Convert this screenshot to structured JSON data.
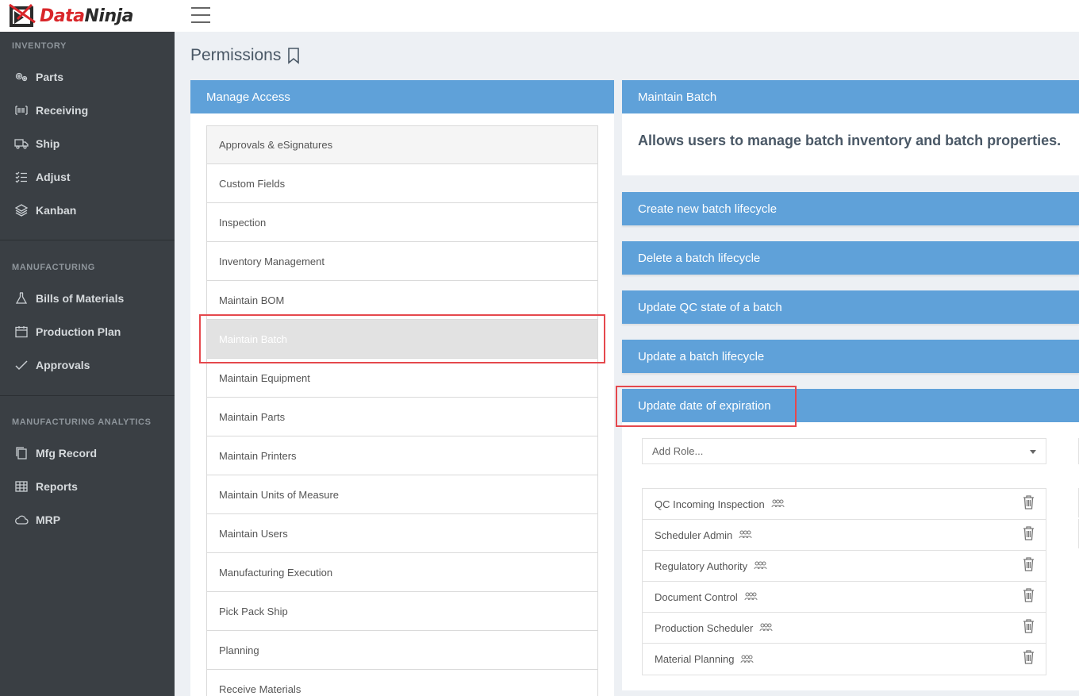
{
  "app": {
    "brand_part1": "Data",
    "brand_part2": "Ninja"
  },
  "sidebar": {
    "sections": [
      {
        "title": "INVENTORY",
        "items": [
          {
            "label": "Parts",
            "icon": "gears-icon"
          },
          {
            "label": "Receiving",
            "icon": "barcode-icon"
          },
          {
            "label": "Ship",
            "icon": "truck-icon"
          },
          {
            "label": "Adjust",
            "icon": "checklist-icon"
          },
          {
            "label": "Kanban",
            "icon": "layers-icon"
          }
        ]
      },
      {
        "title": "MANUFACTURING",
        "items": [
          {
            "label": "Bills of Materials",
            "icon": "flask-icon"
          },
          {
            "label": "Production Plan",
            "icon": "calendar-icon"
          },
          {
            "label": "Approvals",
            "icon": "check-icon"
          }
        ]
      },
      {
        "title": "MANUFACTURING ANALYTICS",
        "items": [
          {
            "label": "Mfg Record",
            "icon": "copy-icon"
          },
          {
            "label": "Reports",
            "icon": "table-icon"
          },
          {
            "label": "MRP",
            "icon": "cloud-icon"
          }
        ]
      }
    ]
  },
  "page": {
    "title": "Permissions"
  },
  "manage_access": {
    "header": "Manage Access",
    "items": [
      "Approvals & eSignatures",
      "Custom Fields",
      "Inspection",
      "Inventory Management",
      "Maintain BOM",
      "Maintain Batch",
      "Maintain Equipment",
      "Maintain Parts",
      "Maintain Printers",
      "Maintain Units of Measure",
      "Maintain Users",
      "Manufacturing Execution",
      "Pick Pack Ship",
      "Planning",
      "Receive Materials"
    ],
    "selected": "Maintain Batch"
  },
  "detail": {
    "header": "Maintain Batch",
    "description": "Allows users to manage batch inventory and batch properties.",
    "actions": [
      "Create new batch lifecycle",
      "Delete a batch lifecycle",
      "Update QC state of a batch",
      "Update a batch lifecycle",
      "Update date of expiration"
    ],
    "add_role_placeholder": "Add Role...",
    "roles": [
      "QC Incoming Inspection",
      "Scheduler Admin",
      "Regulatory Authority",
      "Document Control",
      "Production Scheduler",
      "Material Planning"
    ]
  },
  "colors": {
    "accent": "#5fa1d9",
    "sidebar": "#3a3f44",
    "highlight": "#e5484d",
    "brand_red": "#d9262a"
  }
}
